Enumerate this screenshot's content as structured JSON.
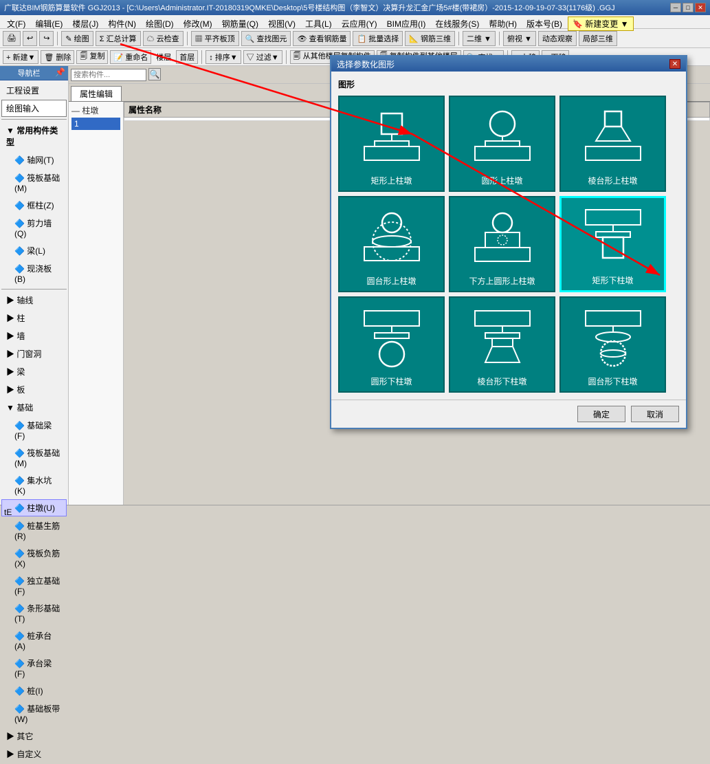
{
  "titlebar": {
    "text": "广联达BIM钢筋算量软件 GGJ2013 - [C:\\Users\\Administrator.IT-20180319QMKE\\Desktop\\5号楼结构图（李智文）决算升龙汇金广场5#楼(带裙房）-2015-12-09-19-07-33(1176级) .GGJ",
    "min": "─",
    "max": "□",
    "close": "✕"
  },
  "menubar": {
    "items": [
      "文(F)",
      "编辑(E)",
      "楼层(J)",
      "构件(N)",
      "绘图(D)",
      "修改(M)",
      "钢筋量(Q)",
      "视图(V)",
      "工具(L)",
      "云应用(Y)",
      "BIM应用(I)",
      "在线服务(S)",
      "帮助(H)",
      "版本号(B)",
      "🔖 新建变更 ▼"
    ]
  },
  "toolbar1": {
    "buttons": [
      "🖨",
      "↩",
      "↪",
      "✎ 绘图",
      "Σ 汇总计算",
      "☁ 云检查",
      "▦ 平齐板顶",
      "🔍 查找图元",
      "👁 查看钢筋量",
      "📋 批量选择",
      "📐 钢筋三维",
      "**",
      "二维 ▼",
      "**",
      "俯视 ▼",
      "动态观察",
      "局部三维"
    ]
  },
  "toolbar2": {
    "new_label": "+ 新建▼",
    "delete_label": "🗑 删除",
    "copy_label": "🗐 复制",
    "rename_label": "📝 重命名",
    "floor_label": "楼层",
    "layer_label": "首层",
    "sort_label": "↕ 排序▼",
    "filter_label": "▽ 过滤▼",
    "copy_from_label": "🗐 从其他楼层复制构件",
    "copy_to_label": "🗐 复制构件到其他楼层",
    "find_label": "🔍 查找▼",
    "up_label": "↑ 上移",
    "down_label": "↓ 下移"
  },
  "left_nav": {
    "title": "导航栏",
    "sections": [
      {
        "label": "工程设置"
      },
      {
        "label": "绘图输入"
      },
      {
        "label": "—"
      },
      {
        "label": "常用构件类型",
        "expanded": true
      },
      {
        "label": "轴网(T)",
        "indent": 2
      },
      {
        "label": "筏板基础(M)",
        "indent": 2
      },
      {
        "label": "框柱(Z)",
        "indent": 2
      },
      {
        "label": "剪力墙(Q)",
        "indent": 2
      },
      {
        "label": "梁(L)",
        "indent": 2
      },
      {
        "label": "现浇板(B)",
        "indent": 2
      },
      {
        "label": "轴线",
        "group": true
      },
      {
        "label": "柱",
        "group": true
      },
      {
        "label": "墙",
        "group": true
      },
      {
        "label": "门窗洞",
        "group": true
      },
      {
        "label": "梁",
        "group": true
      },
      {
        "label": "板",
        "group": true
      },
      {
        "label": "基础",
        "group": true,
        "expanded": true
      },
      {
        "label": "基础梁(F)",
        "indent": 2
      },
      {
        "label": "筏板基础(M)",
        "indent": 2
      },
      {
        "label": "集水坑(K)",
        "indent": 2
      },
      {
        "label": "柱墩(U)",
        "indent": 2,
        "highlighted": true
      },
      {
        "label": "桩基生筋(R)",
        "indent": 2
      },
      {
        "label": "筏板负筋(X)",
        "indent": 2
      },
      {
        "label": "独立基础(F)",
        "indent": 2
      },
      {
        "label": "条形基础(T)",
        "indent": 2
      },
      {
        "label": "桩承台(A)",
        "indent": 2
      },
      {
        "label": "承台梁(F)",
        "indent": 2
      },
      {
        "label": "桩(I)",
        "indent": 2
      },
      {
        "label": "基础板带(W)",
        "indent": 2
      },
      {
        "label": "其它",
        "group": true
      },
      {
        "label": "自定义",
        "group": true
      }
    ]
  },
  "search": {
    "placeholder": "搜索构件...",
    "btn_label": "🔍"
  },
  "content": {
    "tab_label": "属性编辑",
    "table_header": "属性名称",
    "tree_label": "— 柱墩"
  },
  "modal": {
    "title": "选择参数化图形",
    "section_label": "图形",
    "shapes": [
      {
        "id": "s1",
        "label": "矩形上柱墩",
        "selected": false
      },
      {
        "id": "s2",
        "label": "圆形上柱墩",
        "selected": false
      },
      {
        "id": "s3",
        "label": "棱台形上柱墩",
        "selected": false
      },
      {
        "id": "s4",
        "label": "圆台形上柱墩",
        "selected": false
      },
      {
        "id": "s5",
        "label": "下方上圆形上柱墩",
        "selected": false
      },
      {
        "id": "s6",
        "label": "矩形下柱墩",
        "selected": true
      },
      {
        "id": "s7",
        "label": "圆形下柱墩",
        "selected": false
      },
      {
        "id": "s8",
        "label": "棱台形下柱墩",
        "selected": false
      },
      {
        "id": "s9",
        "label": "圆台形下柱墩",
        "selected": false
      }
    ],
    "confirm_label": "确定",
    "cancel_label": "取消"
  },
  "statusbar": {
    "text1": "tE"
  }
}
